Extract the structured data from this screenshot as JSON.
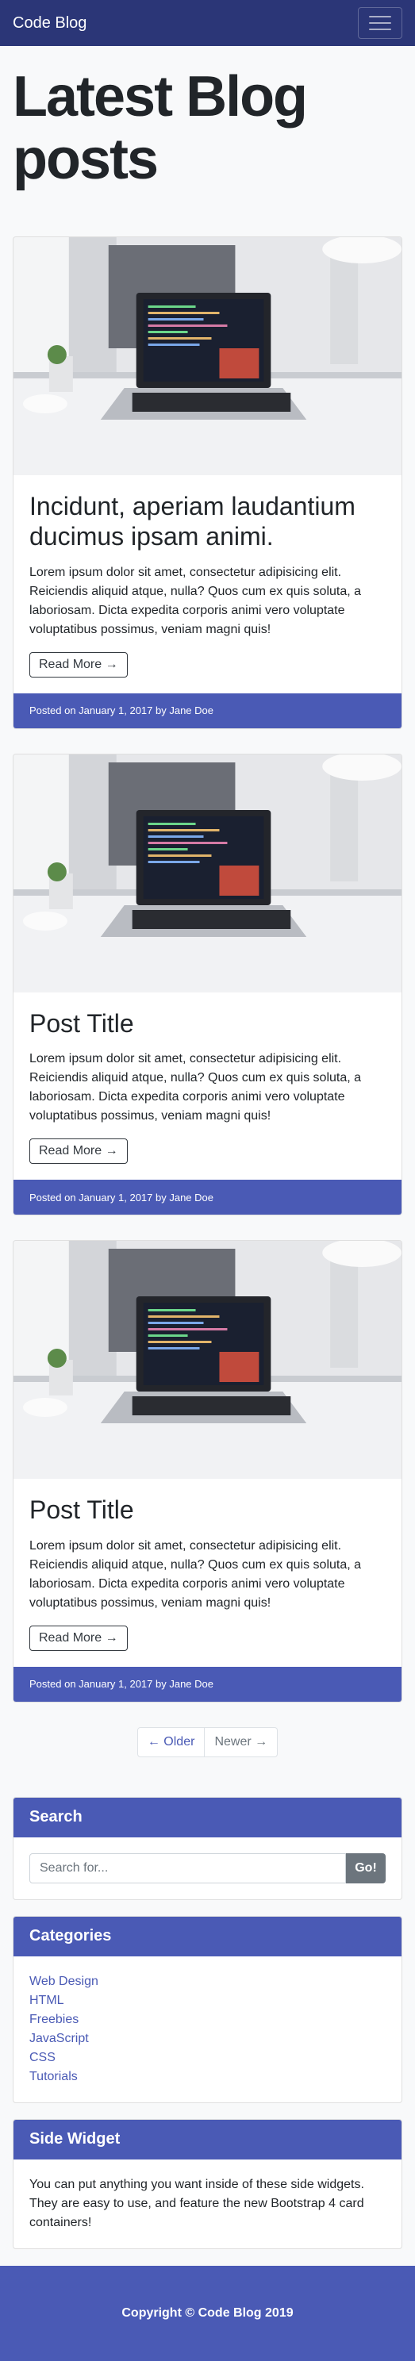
{
  "navbar": {
    "brand": "Code Blog",
    "toggler_icon": "hamburger-icon"
  },
  "page": {
    "heading": "Latest Blog posts"
  },
  "posts": [
    {
      "title": "Incidunt, aperiam laudantium ducimus ipsam animi.",
      "text": "Lorem ipsum dolor sit amet, consectetur adipisicing elit. Reiciendis aliquid atque, nulla? Quos cum ex quis soluta, a laboriosam. Dicta expedita corporis animi vero voluptate voluptatibus possimus, veniam magni quis!",
      "button": "Read More →",
      "footer": "Posted on January 1, 2017 by Jane Doe"
    },
    {
      "title": "Post Title",
      "text": "Lorem ipsum dolor sit amet, consectetur adipisicing elit. Reiciendis aliquid atque, nulla? Quos cum ex quis soluta, a laboriosam. Dicta expedita corporis animi vero voluptate voluptatibus possimus, veniam magni quis!",
      "button": "Read More →",
      "footer": "Posted on January 1, 2017 by Jane Doe"
    },
    {
      "title": "Post Title",
      "text": "Lorem ipsum dolor sit amet, consectetur adipisicing elit. Reiciendis aliquid atque, nulla? Quos cum ex quis soluta, a laboriosam. Dicta expedita corporis animi vero voluptate voluptatibus possimus, veniam magni quis!",
      "button": "Read More →",
      "footer": "Posted on January 1, 2017 by Jane Doe"
    }
  ],
  "pager": {
    "older": "← Older",
    "newer": "Newer →"
  },
  "search": {
    "title": "Search",
    "placeholder": "Search for...",
    "button": "Go!"
  },
  "categories": {
    "title": "Categories",
    "items": [
      "Web Design",
      "HTML",
      "Freebies",
      "JavaScript",
      "CSS",
      "Tutorials"
    ]
  },
  "side_widget": {
    "title": "Side Widget",
    "text": "You can put anything you want inside of these side widgets. They are easy to use, and feature the new Bootstrap 4 card containers!"
  },
  "footer": {
    "text": "Copyright © Code Blog 2019"
  },
  "colors": {
    "navbar": "#2b3677",
    "accent": "#4a5ab5",
    "background": "#f8f9fa"
  }
}
